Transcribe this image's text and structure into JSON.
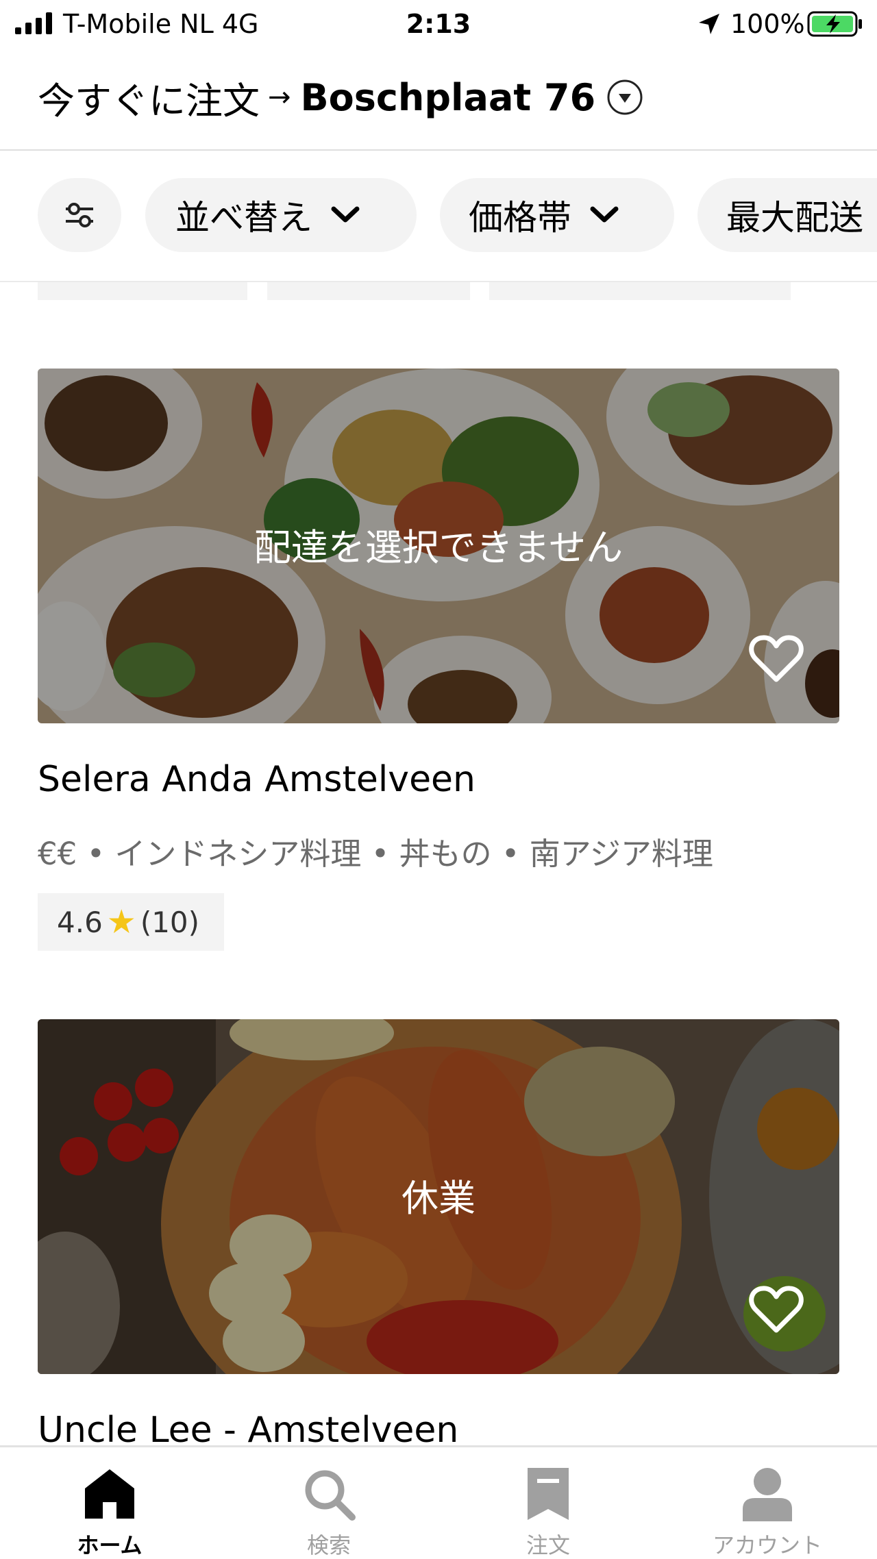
{
  "status_bar": {
    "carrier": "T-Mobile NL   4G",
    "time": "2:13",
    "battery": "100%"
  },
  "header": {
    "prefix": "今すぐに注文",
    "arrow": "→",
    "address": "Boschplaat 76"
  },
  "filters": {
    "sort": "並べ替え",
    "price": "価格帯",
    "max_fee": "最大配送"
  },
  "restaurants": [
    {
      "status": "配達を選択できません",
      "name": "Selera Anda Amstelveen",
      "meta": "€€ • インドネシア料理 • 丼もの • 南アジア料理",
      "rating": "4.6",
      "rating_count": "(10)"
    },
    {
      "status": "休業",
      "name": "Uncle Lee - Amstelveen"
    }
  ],
  "tabs": [
    {
      "label": "ホーム",
      "icon": "home-icon",
      "active": true
    },
    {
      "label": "検索",
      "icon": "search-icon",
      "active": false
    },
    {
      "label": "注文",
      "icon": "receipt-icon",
      "active": false
    },
    {
      "label": "アカウント",
      "icon": "person-icon",
      "active": false
    }
  ],
  "colors": {
    "chip_bg": "#f3f3f3",
    "star": "#f5c518",
    "muted_text": "#6b6b6b",
    "tab_inactive": "#a0a0a0",
    "battery_fill": "#4cd964"
  }
}
